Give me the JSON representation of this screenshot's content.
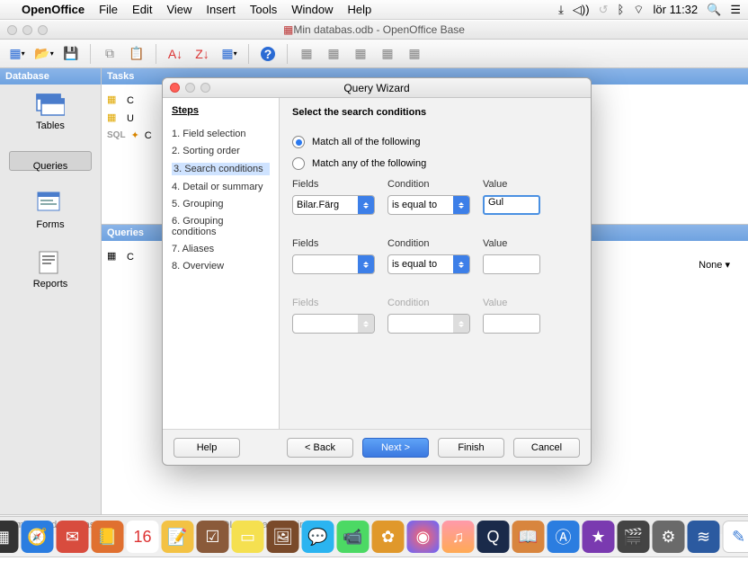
{
  "menubar": {
    "app": "OpenOffice",
    "items": [
      "File",
      "Edit",
      "View",
      "Insert",
      "Tools",
      "Window",
      "Help"
    ],
    "clock": "lör 11:32"
  },
  "window": {
    "title": "Min databas.odb - OpenOffice Base"
  },
  "sidebar": {
    "header": "Database",
    "items": [
      {
        "label": "Tables"
      },
      {
        "label": "Queries"
      },
      {
        "label": "Forms"
      },
      {
        "label": "Reports"
      }
    ]
  },
  "panels": {
    "tasks": "Tasks",
    "queries": "Queries",
    "task_items": [
      "C",
      "U",
      "C"
    ]
  },
  "none_label": "None",
  "status": {
    "left": "Embedded database",
    "right": "HSQL database engine"
  },
  "wizard": {
    "title": "Query Wizard",
    "steps_header": "Steps",
    "steps": [
      "1. Field selection",
      "2. Sorting order",
      "3. Search conditions",
      "4. Detail or summary",
      "5. Grouping",
      "6. Grouping conditions",
      "7. Aliases",
      "8. Overview"
    ],
    "active_step": 2,
    "page_title": "Select the search conditions",
    "match_all": "Match all of the following",
    "match_any": "Match any of the following",
    "labels": {
      "fields": "Fields",
      "condition": "Condition",
      "value": "Value"
    },
    "rows": [
      {
        "field": "Bilar.Färg",
        "condition": "is equal to",
        "value": "Gul",
        "enabled": true,
        "focused": true
      },
      {
        "field": "",
        "condition": "is equal to",
        "value": "",
        "enabled": true,
        "focused": false
      },
      {
        "field": "",
        "condition": "",
        "value": "",
        "enabled": false,
        "focused": false
      }
    ],
    "buttons": {
      "help": "Help",
      "back": "< Back",
      "next": "Next >",
      "finish": "Finish",
      "cancel": "Cancel"
    }
  }
}
